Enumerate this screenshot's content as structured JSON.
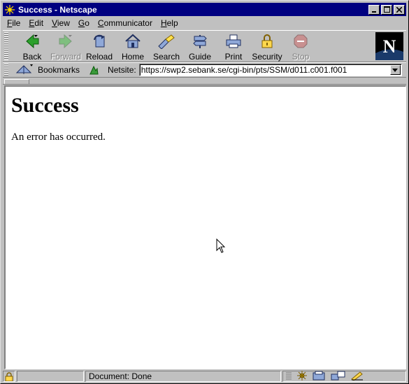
{
  "window": {
    "title": "Success - Netscape"
  },
  "menu": {
    "items": [
      {
        "accel": "F",
        "rest": "ile"
      },
      {
        "accel": "E",
        "rest": "dit"
      },
      {
        "accel": "V",
        "rest": "iew"
      },
      {
        "accel": "G",
        "rest": "o"
      },
      {
        "accel": "C",
        "rest": "ommunicator"
      },
      {
        "accel": "H",
        "rest": "elp"
      }
    ]
  },
  "toolbar": {
    "back": "Back",
    "forward": "Forward",
    "reload": "Reload",
    "home": "Home",
    "search": "Search",
    "guide": "Guide",
    "print": "Print",
    "security": "Security",
    "stop": "Stop",
    "logo_letter": "N"
  },
  "location": {
    "bookmarks_label": "Bookmarks",
    "netsite_label": "Netsite:",
    "url": "https://swp2.sebank.se/cgi-bin/pts/SSM/d011.c001.f001"
  },
  "page": {
    "heading": "Success",
    "message": "An error has occurred."
  },
  "status": {
    "text": "Document: Done"
  },
  "colors": {
    "titlebar": "#000080",
    "chrome": "#c0c0c0",
    "content_bg": "#ffffff"
  }
}
